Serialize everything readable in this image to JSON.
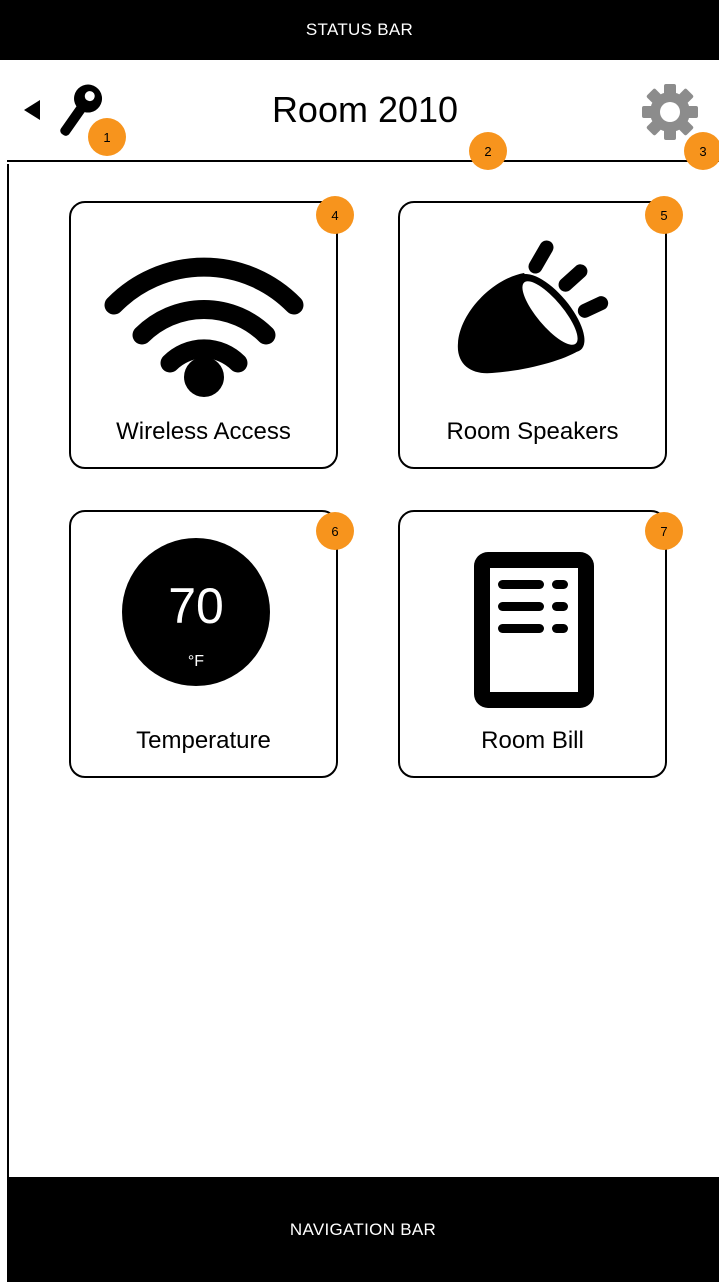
{
  "status_bar": {
    "label": "STATUS BAR"
  },
  "header": {
    "title": "Room 2010",
    "back_icon": "back-arrow-icon",
    "key_icon": "key-icon",
    "settings_icon": "gear-icon"
  },
  "badges": [
    "1",
    "2",
    "3",
    "4",
    "5",
    "6",
    "7"
  ],
  "tiles": [
    {
      "label": "Wireless Access",
      "icon": "wifi-icon"
    },
    {
      "label": "Room Speakers",
      "icon": "speaker-icon"
    },
    {
      "label": "Temperature",
      "icon": "thermostat-icon",
      "value": "70",
      "unit": "°F"
    },
    {
      "label": "Room Bill",
      "icon": "bill-icon"
    }
  ],
  "navigation_bar": {
    "label": "NAVIGATION BAR"
  },
  "colors": {
    "badge": "#f7941d",
    "bars": "#000000",
    "icon_gray": "#8c8c8c"
  }
}
